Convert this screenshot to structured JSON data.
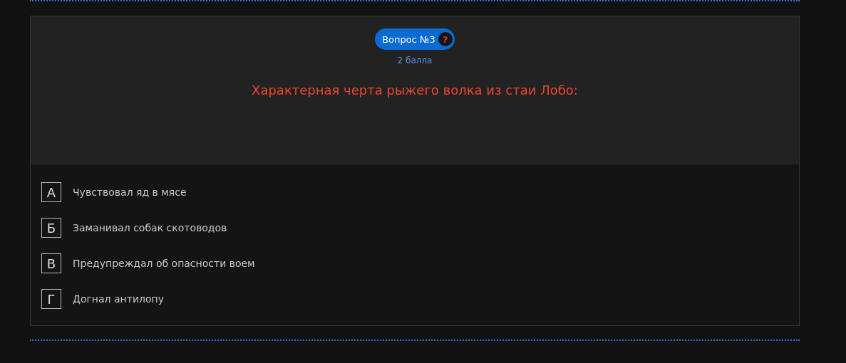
{
  "question": {
    "badge": "Вопрос №3",
    "help": "?",
    "points": "2 балла",
    "text": "Характерная черта рыжего волка из стаи Лобо:"
  },
  "answers": [
    {
      "letter": "А",
      "text": "Чувствовал яд в мясе",
      "selected": false
    },
    {
      "letter": "Б",
      "text": "Заманивал собак скотоводов",
      "selected": false
    },
    {
      "letter": "В",
      "text": "Предупреждал об опасности воем",
      "selected": false
    },
    {
      "letter": "Г",
      "text": "Догнал антилопу",
      "selected": false
    }
  ]
}
